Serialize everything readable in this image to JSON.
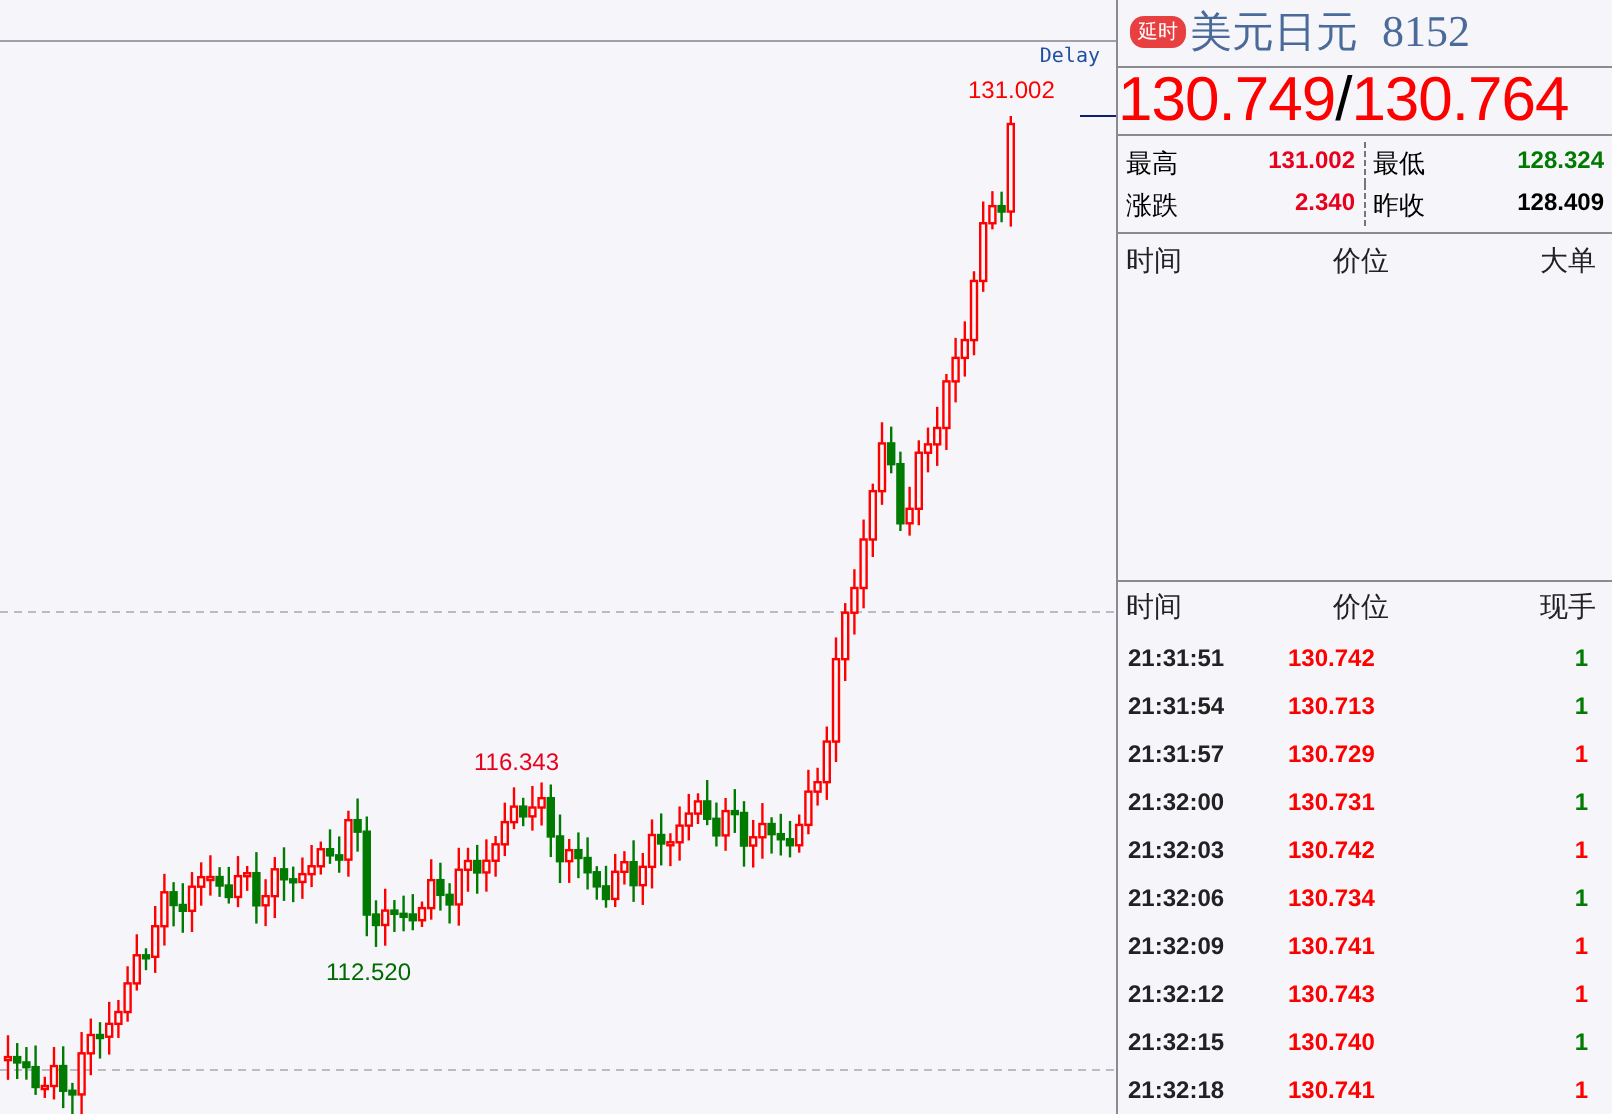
{
  "chart": {
    "delay_label": "Delay",
    "high_label": "131.002",
    "peak_label": "116.343",
    "low_label": "112.520"
  },
  "quote": {
    "badge": "延时",
    "name": "美元日元",
    "code": "8152",
    "bid": "130.749",
    "separator": "/",
    "ask": "130.764",
    "stats": [
      {
        "label": "最高",
        "value": "131.002",
        "color": "#e8001c"
      },
      {
        "label": "最低",
        "value": "128.324",
        "color": "#007a00"
      },
      {
        "label": "涨跌",
        "value": "2.340",
        "color": "#e8001c"
      },
      {
        "label": "昨收",
        "value": "128.409",
        "color": "#000000"
      }
    ]
  },
  "big_orders": {
    "columns": [
      "时间",
      "价位",
      "大单"
    ]
  },
  "ticks": {
    "columns": [
      "时间",
      "价位",
      "现手"
    ],
    "rows": [
      {
        "time": "21:31:51",
        "price": "130.742",
        "volume": "1",
        "color": "#007a00"
      },
      {
        "time": "21:31:54",
        "price": "130.713",
        "volume": "1",
        "color": "#007a00"
      },
      {
        "time": "21:31:57",
        "price": "130.729",
        "volume": "1",
        "color": "#ff0000"
      },
      {
        "time": "21:32:00",
        "price": "130.731",
        "volume": "1",
        "color": "#007a00"
      },
      {
        "time": "21:32:03",
        "price": "130.742",
        "volume": "1",
        "color": "#ff0000"
      },
      {
        "time": "21:32:06",
        "price": "130.734",
        "volume": "1",
        "color": "#007a00"
      },
      {
        "time": "21:32:09",
        "price": "130.741",
        "volume": "1",
        "color": "#ff0000"
      },
      {
        "time": "21:32:12",
        "price": "130.743",
        "volume": "1",
        "color": "#ff0000"
      },
      {
        "time": "21:32:15",
        "price": "130.740",
        "volume": "1",
        "color": "#007a00"
      },
      {
        "time": "21:32:18",
        "price": "130.741",
        "volume": "1",
        "color": "#ff0000"
      }
    ]
  }
}
